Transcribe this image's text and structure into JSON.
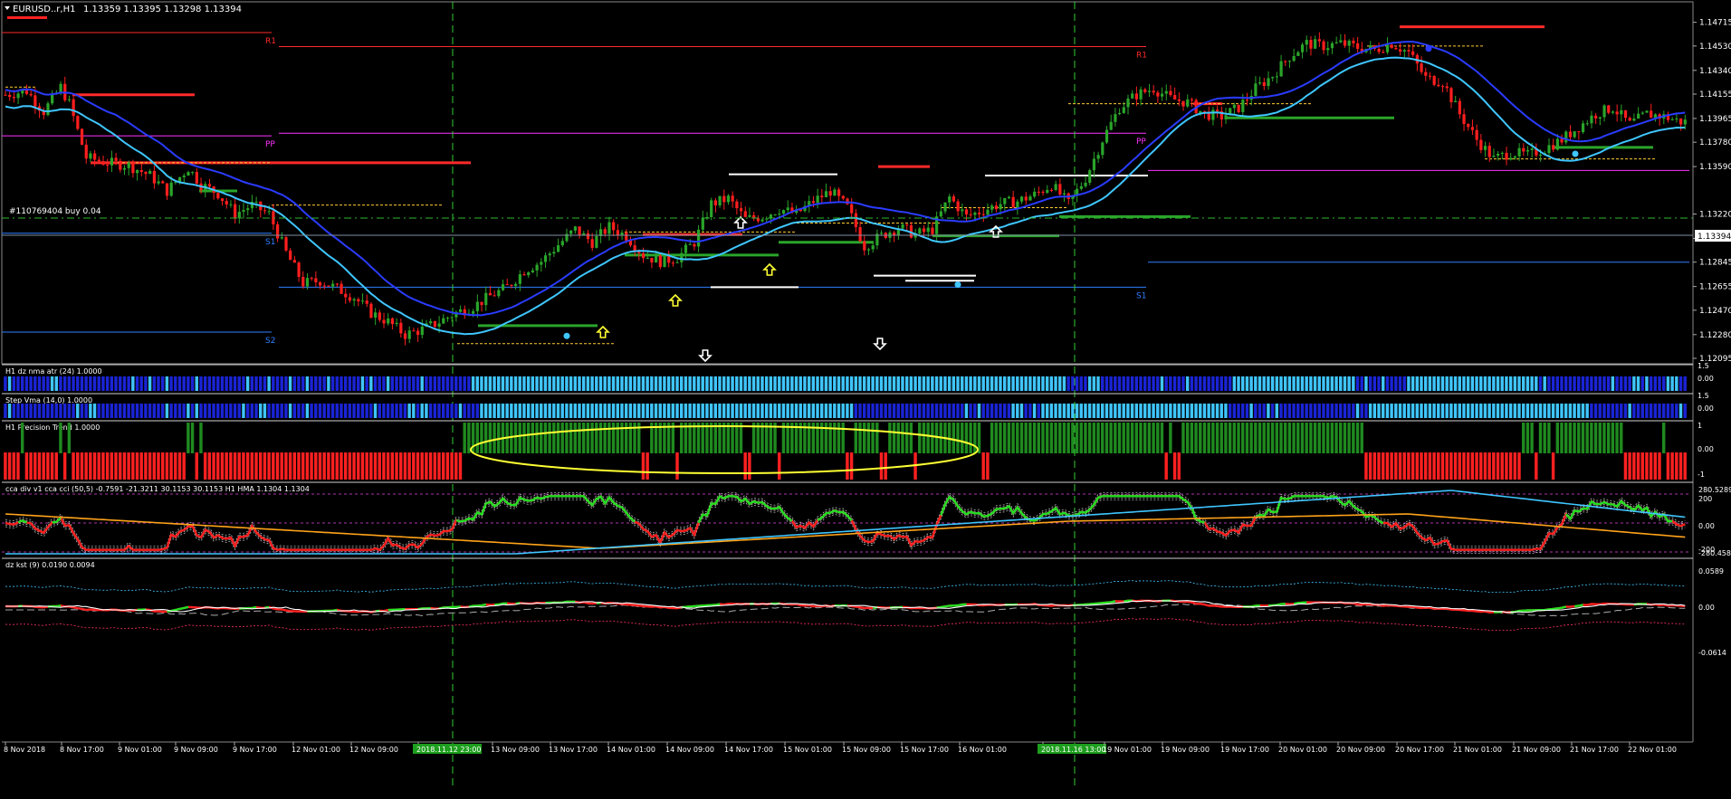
{
  "window": {
    "symbol_title": "EURUSD..r,H1",
    "ohlc": "1.13359 1.13395 1.13298 1.13394",
    "order_label": "#110769404 buy 0.04",
    "current_price": "1.13394"
  },
  "colors": {
    "background": "#000000",
    "bull": "#2aa52a",
    "bear": "#ff1e1e",
    "grid": "#ffffff",
    "separator": "#cfcfcf",
    "vline": "#33cc33",
    "ma_blue": "#2a3cff",
    "ma_cyan": "#3fc6ff",
    "pivot_red": "#ff2a2a",
    "pivot_magenta": "#ff33ff",
    "pivot_blue": "#2f7fff",
    "ellipse": "#ffff33",
    "orange": "#ffa31a",
    "green_line": "#22e022",
    "white": "#ffffff"
  },
  "chart_data": {
    "type": "candlestick",
    "price_axis": [
      "1.14715",
      "1.14530",
      "1.14340",
      "1.14155",
      "1.13965",
      "1.13780",
      "1.13590",
      "1.13220",
      "1.13030",
      "1.12845",
      "1.12655",
      "1.12470",
      "1.12280",
      "1.12095"
    ],
    "price_range": [
      1.12095,
      1.1479
    ],
    "time_axis": [
      "8 Nov 2018",
      "8 Nov 17:00",
      "9 Nov 01:00",
      "9 Nov 09:00",
      "9 Nov 17:00",
      "12 Nov 01:00",
      "12 Nov 09:00",
      "2018.11.12 23:00",
      "13 Nov 09:00",
      "13 Nov 17:00",
      "14 Nov 01:00",
      "14 Nov 09:00",
      "14 Nov 17:00",
      "15 Nov 01:00",
      "15 Nov 09:00",
      "15 Nov 17:00",
      "16 Nov 01:00",
      "2018.11.16 13:00",
      "19 Nov 01:00",
      "19 Nov 09:00",
      "19 Nov 17:00",
      "20 Nov 01:00",
      "20 Nov 09:00",
      "20 Nov 17:00",
      "21 Nov 01:00",
      "21 Nov 09:00",
      "21 Nov 17:00",
      "22 Nov 01:00"
    ],
    "highlighted_times": [
      "2018.11.12 23:00",
      "2018.11.16 13:00"
    ],
    "close_path": [
      [
        0,
        1.1415
      ],
      [
        5,
        1.1418
      ],
      [
        9,
        1.1402
      ],
      [
        13,
        1.1421
      ],
      [
        15,
        1.1408
      ],
      [
        19,
        1.1366
      ],
      [
        24,
        1.1362
      ],
      [
        29,
        1.136
      ],
      [
        34,
        1.1352
      ],
      [
        38,
        1.134
      ],
      [
        43,
        1.1358
      ],
      [
        46,
        1.1345
      ],
      [
        50,
        1.1338
      ],
      [
        54,
        1.1322
      ],
      [
        58,
        1.1329
      ],
      [
        62,
        1.1322
      ],
      [
        66,
        1.1292
      ],
      [
        70,
        1.1268
      ],
      [
        74,
        1.127
      ],
      [
        78,
        1.1264
      ],
      [
        82,
        1.1257
      ],
      [
        86,
        1.1245
      ],
      [
        90,
        1.1238
      ],
      [
        94,
        1.1228
      ],
      [
        98,
        1.1232
      ],
      [
        102,
        1.1238
      ],
      [
        106,
        1.1245
      ],
      [
        110,
        1.125
      ],
      [
        114,
        1.1258
      ],
      [
        118,
        1.1265
      ],
      [
        122,
        1.1278
      ],
      [
        126,
        1.1285
      ],
      [
        130,
        1.1298
      ],
      [
        134,
        1.131
      ],
      [
        138,
        1.13
      ],
      [
        142,
        1.1312
      ],
      [
        146,
        1.1305
      ],
      [
        150,
        1.129
      ],
      [
        154,
        1.1285
      ],
      [
        158,
        1.1288
      ],
      [
        162,
        1.13
      ],
      [
        166,
        1.133
      ],
      [
        170,
        1.1334
      ],
      [
        174,
        1.1318
      ],
      [
        178,
        1.132
      ],
      [
        182,
        1.1326
      ],
      [
        186,
        1.1322
      ],
      [
        190,
        1.1332
      ],
      [
        194,
        1.134
      ],
      [
        198,
        1.1327
      ],
      [
        202,
        1.1297
      ],
      [
        206,
        1.1305
      ],
      [
        210,
        1.1312
      ],
      [
        214,
        1.1306
      ],
      [
        218,
        1.131
      ],
      [
        222,
        1.1335
      ],
      [
        226,
        1.132
      ],
      [
        230,
        1.1325
      ],
      [
        234,
        1.133
      ],
      [
        238,
        1.1332
      ],
      [
        242,
        1.1337
      ],
      [
        246,
        1.1345
      ],
      [
        250,
        1.133
      ],
      [
        254,
        1.135
      ],
      [
        258,
        1.138
      ],
      [
        262,
        1.1405
      ],
      [
        266,
        1.1415
      ],
      [
        270,
        1.142
      ],
      [
        274,
        1.1412
      ],
      [
        278,
        1.1409
      ],
      [
        282,
        1.14
      ],
      [
        286,
        1.1398
      ],
      [
        290,
        1.1405
      ],
      [
        294,
        1.142
      ],
      [
        298,
        1.143
      ],
      [
        302,
        1.1445
      ],
      [
        306,
        1.1455
      ],
      [
        310,
        1.1453
      ],
      [
        314,
        1.1455
      ],
      [
        318,
        1.1452
      ],
      [
        322,
        1.145
      ],
      [
        326,
        1.1455
      ],
      [
        330,
        1.1448
      ],
      [
        334,
        1.1428
      ],
      [
        338,
        1.1425
      ],
      [
        342,
        1.14
      ],
      [
        346,
        1.138
      ],
      [
        350,
        1.1365
      ],
      [
        354,
        1.137
      ],
      [
        358,
        1.1368
      ],
      [
        362,
        1.1373
      ],
      [
        366,
        1.138
      ],
      [
        370,
        1.139
      ],
      [
        374,
        1.14
      ],
      [
        378,
        1.1405
      ],
      [
        382,
        1.1392
      ],
      [
        386,
        1.14
      ],
      [
        390,
        1.1398
      ],
      [
        394,
        1.1394
      ]
    ],
    "pivot_levels": {
      "R1": "1.14635",
      "PP": "1.13830",
      "S1": "1.13070",
      "S2": "1.12300",
      "R1_second": "1.14525",
      "S1_second": "1.12650",
      "PP_second": "1.13850"
    },
    "level_labels": [
      "R1",
      "PP",
      "S1",
      "S2",
      "R1",
      "PP",
      "S1"
    ],
    "indicator_panels": [
      {
        "name": "H1 dz nma atr (24) 1.0000",
        "type": "histogram",
        "levels": [
          "1.5",
          "0.00"
        ]
      },
      {
        "name": "Step Vma  (14,0) 1.0000",
        "type": "histogram",
        "levels": [
          "1.5",
          "0.00"
        ]
      },
      {
        "name": "H1 Precision Trend 1.0000",
        "type": "histogram",
        "levels": [
          "1",
          "0.00",
          "-1"
        ]
      },
      {
        "name": "cca div v1 cca cci (50,5) -0.7591 -21.3211 30.1153 30.1153  H1 HMA 1.1304 1.1304",
        "type": "line",
        "levels": [
          "280.5289",
          "200",
          "0.00",
          "-200",
          "-280.4581"
        ]
      },
      {
        "name": "dz kst (9) 0.0190 0.0094",
        "type": "line",
        "levels": [
          "0.0589",
          "0.00",
          "-0.0614"
        ]
      }
    ]
  }
}
